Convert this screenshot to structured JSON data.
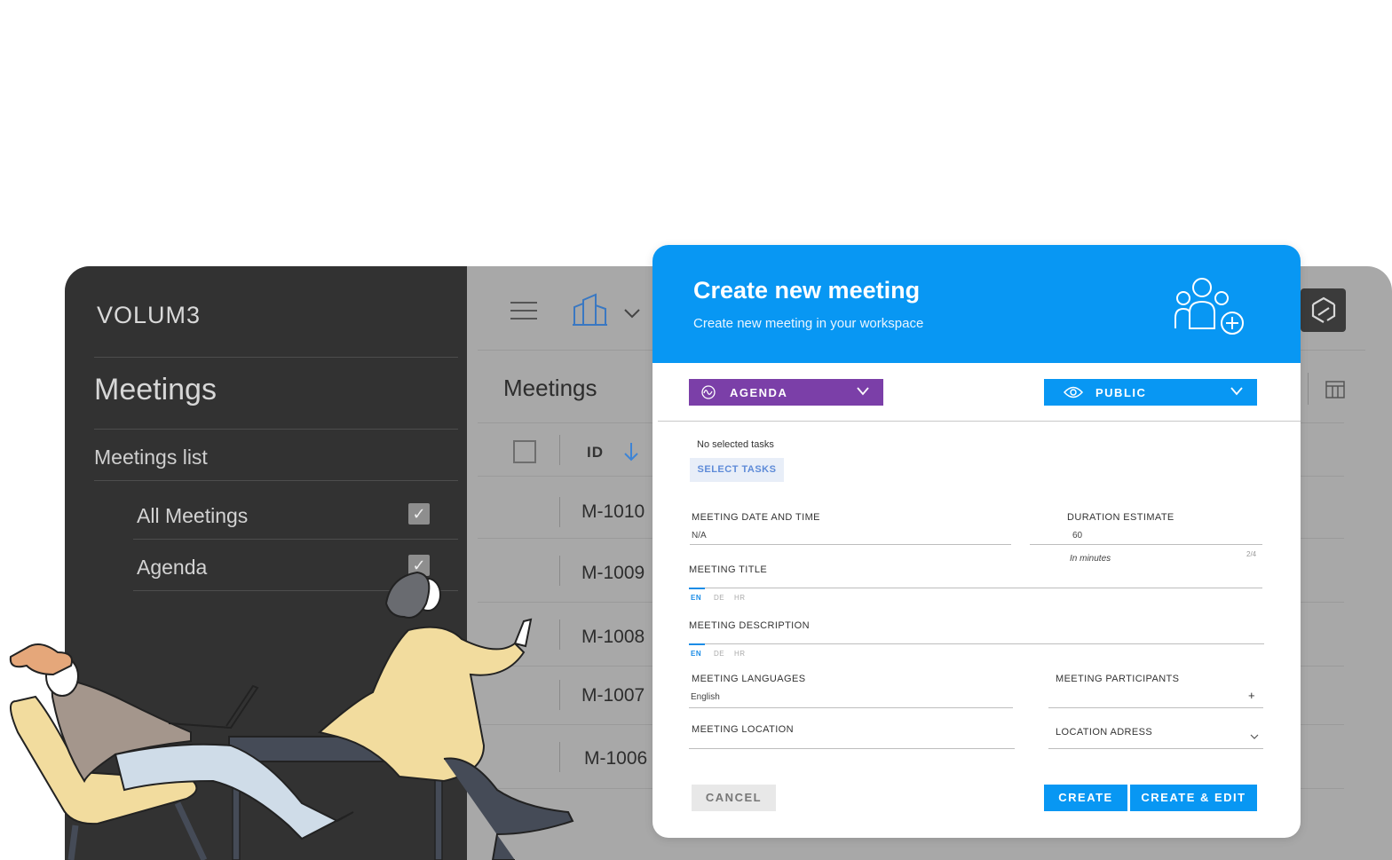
{
  "app": {
    "brand": "VOLUM3"
  },
  "sidebar": {
    "title": "Meetings",
    "subtitle": "Meetings list",
    "items": [
      {
        "label": "All Meetings",
        "checked": true
      },
      {
        "label": "Agenda",
        "checked": true
      }
    ]
  },
  "topbar": {
    "menu_icon": "hamburger-icon",
    "building_icon": "building-icon",
    "dropdown_icon": "chevron-down-icon"
  },
  "main": {
    "title": "Meetings",
    "table": {
      "header": {
        "id_label": "ID",
        "sort_icon": "arrow-down-icon"
      },
      "rows": [
        "M-1010",
        "M-1009",
        "M-1008",
        "M-1007",
        "M-1006"
      ]
    }
  },
  "modal": {
    "title": "Create new meeting",
    "subtitle": "Create new meeting in your workspace",
    "header_icon": "add-participants-icon",
    "type_select": {
      "label": "AGENDA",
      "color": "#7b3fa8",
      "icon": "pulse-icon"
    },
    "visibility_select": {
      "label": "PUBLIC",
      "color": "#0897f3",
      "icon": "eye-icon"
    },
    "tasks": {
      "empty_text": "No selected tasks",
      "select_button": "SELECT TASKS"
    },
    "date_time": {
      "label": "MEETING DATE AND TIME",
      "value": "N/A"
    },
    "duration": {
      "label": "DURATION ESTIMATE",
      "value": "60",
      "hint": "In minutes",
      "counter": "2/4"
    },
    "meeting_title": {
      "label": "MEETING TITLE",
      "langs": [
        "EN",
        "DE",
        "HR"
      ]
    },
    "meeting_description": {
      "label": "MEETING DESCRIPTION",
      "langs": [
        "EN",
        "DE",
        "HR"
      ]
    },
    "languages": {
      "label": "MEETING LANGUAGES",
      "value": "English"
    },
    "participants": {
      "label": "MEETING PARTICIPANTS",
      "add": "+"
    },
    "location": {
      "label": "MEETING  LOCATION"
    },
    "location_address": {
      "label": "LOCATION ADRESS"
    },
    "buttons": {
      "cancel": "CANCEL",
      "create": "CREATE",
      "create_edit": "CREATE & EDIT"
    }
  }
}
